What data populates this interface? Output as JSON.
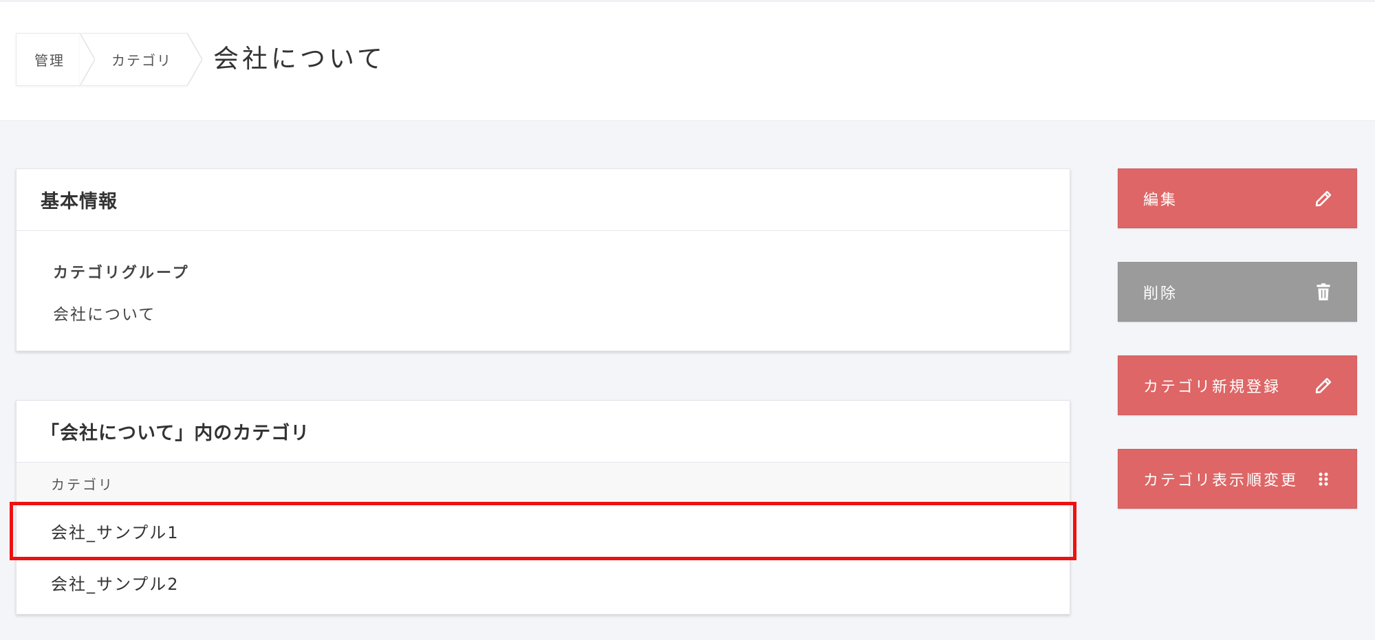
{
  "breadcrumb": {
    "items": [
      {
        "label": "管理"
      },
      {
        "label": "カテゴリ"
      }
    ]
  },
  "page": {
    "title": "会社について"
  },
  "basic_info": {
    "heading": "基本情報",
    "field_label": "カテゴリグループ",
    "field_value": "会社について"
  },
  "categories_panel": {
    "heading": "「会社について」内のカテゴリ",
    "column_header": "カテゴリ",
    "rows": [
      {
        "label": "会社_サンプル1",
        "selected": true
      },
      {
        "label": "会社_サンプル2",
        "selected": false
      }
    ]
  },
  "actions": {
    "edit": {
      "label": "編集",
      "icon": "pencil-icon"
    },
    "delete": {
      "label": "削除",
      "icon": "trash-icon"
    },
    "new_category": {
      "label": "カテゴリ新規登録",
      "icon": "pencil-icon"
    },
    "reorder": {
      "label": "カテゴリ表示順変更",
      "icon": "drag-handle-icon"
    }
  },
  "colors": {
    "primary_button": "#de6666",
    "delete_button": "#9b9b9b",
    "highlight": "#ee1111",
    "background": "#f4f5f9"
  }
}
